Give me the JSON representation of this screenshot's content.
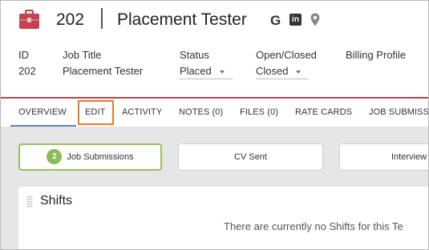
{
  "header": {
    "record_id": "202",
    "title": "Placement Tester",
    "icons": [
      "briefcase-icon",
      "google-icon",
      "linkedin-icon",
      "map-pin-icon"
    ],
    "google_glyph": "G",
    "linkedin_glyph": "in",
    "brand_color": "#c0434f"
  },
  "fields": [
    {
      "label": "ID",
      "value": "202"
    },
    {
      "label": "Job Title",
      "value": "Placement Tester"
    },
    {
      "label": "Status",
      "value": "Placed"
    },
    {
      "label": "Open/Closed",
      "value": "Closed"
    },
    {
      "label": "Billing Profile",
      "value": ""
    }
  ],
  "tabs": [
    "OVERVIEW",
    "EDIT",
    "ACTIVITY",
    "NOTES (0)",
    "FILES (0)",
    "RATE CARDS",
    "JOB SUBMISSIONS"
  ],
  "active_tab": "OVERVIEW",
  "highlighted_tab": "EDIT",
  "pipeline": {
    "steps": [
      {
        "count": "2",
        "label": "Job Submissions"
      },
      {
        "label": "CV Sent"
      },
      {
        "label": "Interview"
      }
    ]
  },
  "shifts": {
    "title": "Shifts",
    "empty_message": "There are currently no Shifts for this Te"
  }
}
